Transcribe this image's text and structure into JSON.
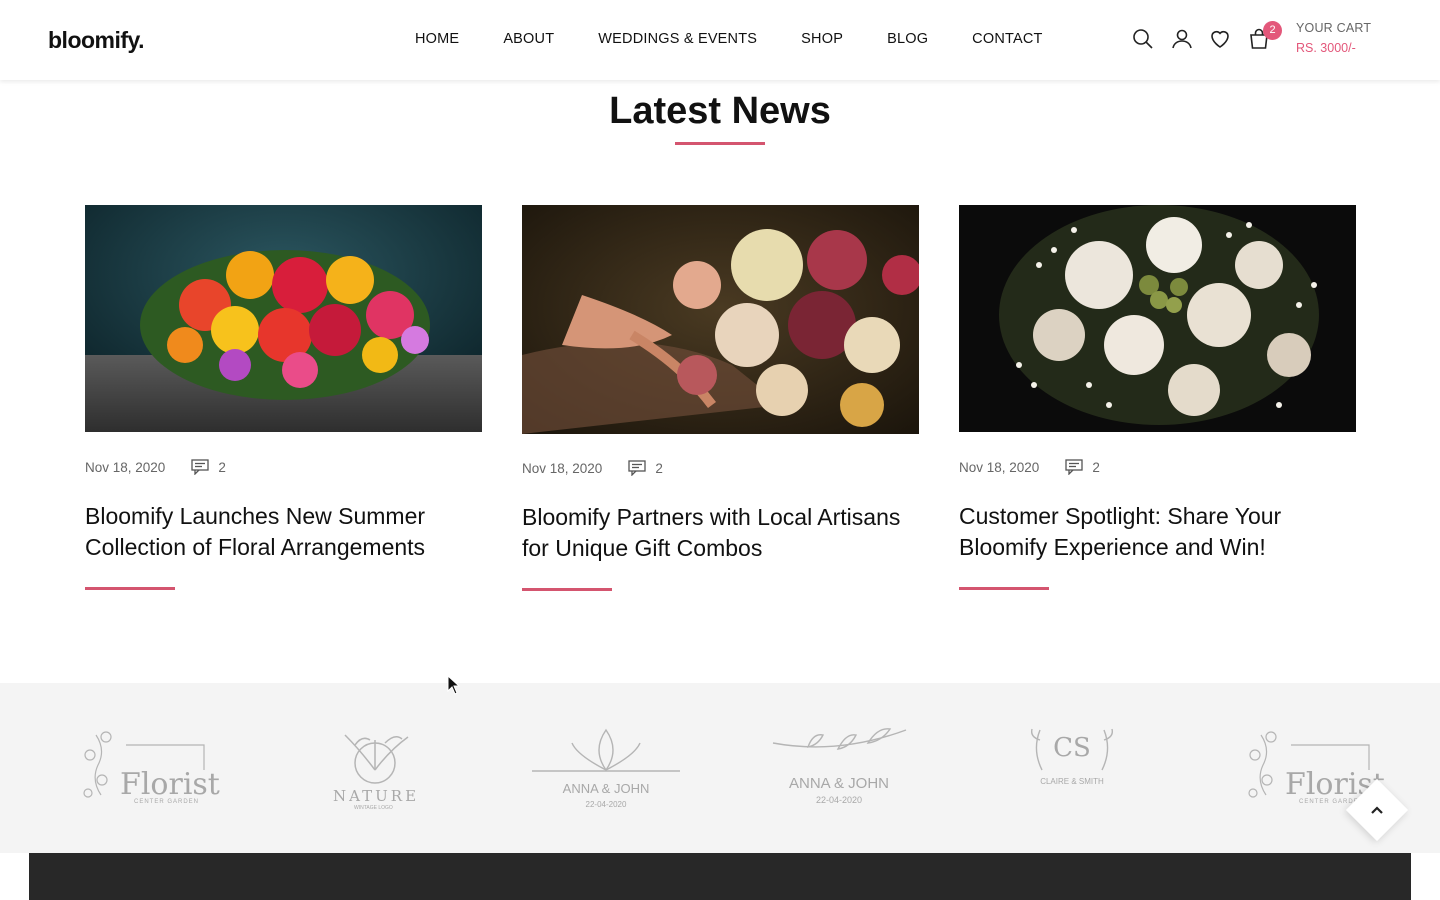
{
  "header": {
    "logo": "bloomify.",
    "nav": [
      "HOME",
      "ABOUT",
      "WEDDINGS & EVENTS",
      "SHOP",
      "BLOG",
      "CONTACT"
    ],
    "cart": {
      "badge": "2",
      "title": "YOUR CART",
      "total": "RS. 3000/-"
    }
  },
  "section": {
    "title": "Latest News"
  },
  "posts": [
    {
      "date": "Nov 18, 2020",
      "comments": "2",
      "title": "Bloomify Launches New Summer Collection of Floral Arrangements"
    },
    {
      "date": "Nov 18, 2020",
      "comments": "2",
      "title": "Bloomify Partners with Local Artisans for Unique Gift Combos"
    },
    {
      "date": "Nov 18, 2020",
      "comments": "2",
      "title": "Customer Spotlight: Share Your Bloomify Experience and Win!"
    }
  ],
  "brands": [
    {
      "name": "Florist",
      "sub": "CENTER GARDEN"
    },
    {
      "name": "NATURE",
      "sub": "WINTAGE LOGO"
    },
    {
      "name": "ANNA & JOHN",
      "sub": "22-04-2020"
    },
    {
      "name": "ANNA & JOHN",
      "sub": "22-04-2020"
    },
    {
      "name": "CS",
      "sub": "CLAIRE & SMITH"
    },
    {
      "name": "Florist",
      "sub": "CENTER GARDEN"
    }
  ],
  "colors": {
    "accent": "#d4556f",
    "badge": "#e3577a",
    "footer": "#282828",
    "brand_strip": "#f4f4f4"
  }
}
